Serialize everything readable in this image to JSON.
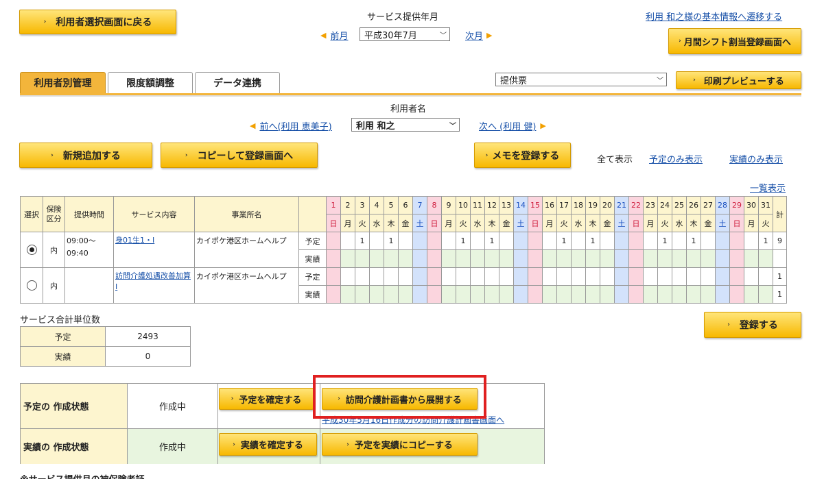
{
  "header": {
    "back_button": "利用者選択画面に戻る",
    "service_month_label": "サービス提供年月",
    "prev_month": "前月",
    "month_value": "平成30年7月",
    "next_month": "次月",
    "basic_info_link": "利用 和之様の基本情報へ遷移する",
    "shift_button": "月間シフト割当登録画面へ"
  },
  "tabs": [
    {
      "label": "利用者別管理",
      "active": true
    },
    {
      "label": "限度額調整",
      "active": false
    },
    {
      "label": "データ連携",
      "active": false
    }
  ],
  "print": {
    "select_value": "提供票",
    "preview_button": "印刷プレビューする"
  },
  "user": {
    "label": "利用者名",
    "prev": "前へ(利用 恵美子)",
    "value": "利用 和之",
    "next": "次へ (利用 健)"
  },
  "actions": {
    "new_button": "新規追加する",
    "copy_button": "コピーして登録画面へ",
    "memo_button": "メモを登録する",
    "show_all": "全て表示",
    "show_plan": "予定のみ表示",
    "show_actual": "実績のみ表示",
    "list_view": "一覧表示"
  },
  "schedule": {
    "headers": {
      "select": "選択",
      "insurance": "保険区分",
      "time": "提供時間",
      "service": "サービス内容",
      "office": "事業所名",
      "total": "計"
    },
    "days": [
      "1",
      "2",
      "3",
      "4",
      "5",
      "6",
      "7",
      "8",
      "9",
      "10",
      "11",
      "12",
      "13",
      "14",
      "15",
      "16",
      "17",
      "18",
      "19",
      "20",
      "21",
      "22",
      "23",
      "24",
      "25",
      "26",
      "27",
      "28",
      "29",
      "30",
      "31"
    ],
    "weekdays": [
      "日",
      "月",
      "火",
      "水",
      "木",
      "金",
      "土",
      "日",
      "月",
      "火",
      "水",
      "木",
      "金",
      "土",
      "日",
      "月",
      "火",
      "水",
      "木",
      "金",
      "土",
      "日",
      "月",
      "火",
      "水",
      "木",
      "金",
      "土",
      "日",
      "月",
      "火"
    ],
    "plan_label": "予定",
    "actual_label": "実績",
    "rows": [
      {
        "selected": true,
        "insurance": "内",
        "time": "09:00〜09:40",
        "service": "身01生1・I",
        "office": "カイポケ港区ホームヘルプ",
        "plan": [
          "",
          "",
          "1",
          "",
          "1",
          "",
          "",
          "",
          "",
          "1",
          "",
          "1",
          "",
          "",
          "",
          "",
          "1",
          "",
          "1",
          "",
          "",
          "",
          "",
          "1",
          "",
          "1",
          "",
          "",
          "",
          "",
          "1"
        ],
        "plan_total": "9",
        "actual": [
          "",
          "",
          "",
          "",
          "",
          "",
          "",
          "",
          "",
          "",
          "",
          "",
          "",
          "",
          "",
          "",
          "",
          "",
          "",
          "",
          "",
          "",
          "",
          "",
          "",
          "",
          "",
          "",
          "",
          "",
          ""
        ],
        "actual_total": ""
      },
      {
        "selected": false,
        "insurance": "内",
        "time": "",
        "service": "訪問介護処遇改善加算I",
        "office": "カイポケ港区ホームヘルプ",
        "plan": [
          "",
          "",
          "",
          "",
          "",
          "",
          "",
          "",
          "",
          "",
          "",
          "",
          "",
          "",
          "",
          "",
          "",
          "",
          "",
          "",
          "",
          "",
          "",
          "",
          "",
          "",
          "",
          "",
          "",
          "",
          ""
        ],
        "plan_total": "1",
        "actual": [
          "",
          "",
          "",
          "",
          "",
          "",
          "",
          "",
          "",
          "",
          "",
          "",
          "",
          "",
          "",
          "",
          "",
          "",
          "",
          "",
          "",
          "",
          "",
          "",
          "",
          "",
          "",
          "",
          "",
          "",
          ""
        ],
        "actual_total": "1"
      }
    ]
  },
  "units": {
    "title": "サービス合計単位数",
    "plan_label": "予定",
    "plan_value": "2493",
    "actual_label": "実績",
    "actual_value": "0"
  },
  "register_button": "登録する",
  "status": {
    "plan_label": "予定の 作成状態",
    "plan_value": "作成中",
    "confirm_plan_button": "予定を確定する",
    "expand_button": "訪問介護計画書から展開する",
    "plan_link": "平成30年5月16日作成分の訪問介護計画書画面へ",
    "actual_label": "実績の 作成状態",
    "actual_value": "作成中",
    "confirm_actual_button": "実績を確定する",
    "copy_to_actual_button": "予定を実績にコピーする"
  },
  "footer_cut": "※サービス提供月の被保険者証",
  "colors": {
    "accent": "#f7b800",
    "sunday": "#fbd5de",
    "saturday": "#d3e2fb",
    "highlight": "#e02020"
  }
}
